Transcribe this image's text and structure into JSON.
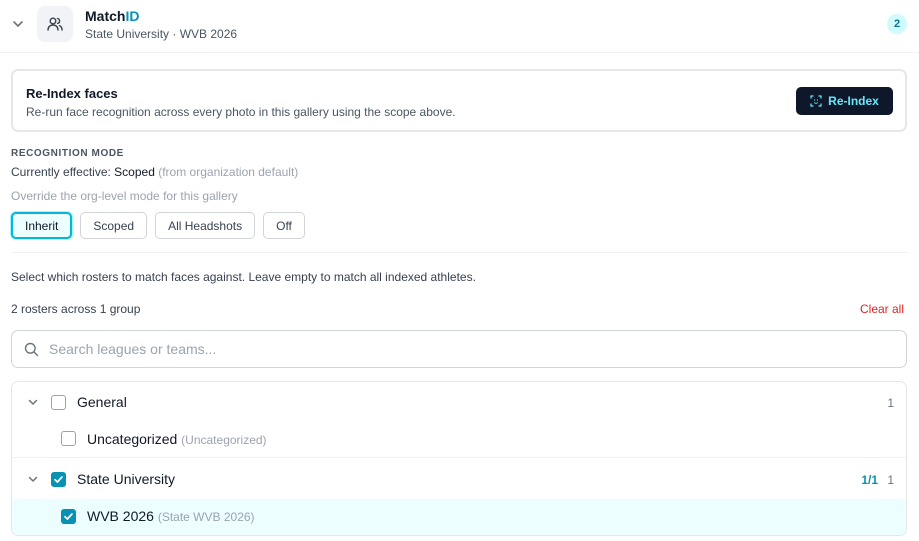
{
  "header": {
    "title_main": "Match",
    "title_accent": "ID",
    "subtitle": "State University · WVB 2026",
    "badge_count": "2",
    "collapse_icon": "chevron-down-icon",
    "app_icon": "users-icon"
  },
  "reindex": {
    "title": "Re-Index faces",
    "description": "Re-run face recognition across every photo in this gallery using the scope above.",
    "button_label": "Re-Index",
    "button_icon": "face-scan-icon"
  },
  "recognition": {
    "section_label": "RECOGNITION MODE",
    "effective_prefix": "Currently effective:",
    "effective_value": "Scoped",
    "effective_note": "(from organization default)",
    "override_hint": "Override the org-level mode for this gallery",
    "modes": [
      {
        "label": "Inherit",
        "active": true
      },
      {
        "label": "Scoped",
        "active": false
      },
      {
        "label": "All Headshots",
        "active": false
      },
      {
        "label": "Off",
        "active": false
      }
    ]
  },
  "rosters": {
    "hint": "Select which rosters to match faces against. Leave empty to match all indexed athletes.",
    "summary": "2 rosters across 1 group",
    "clear_label": "Clear all",
    "search_placeholder": "Search leagues or teams...",
    "groups": [
      {
        "name": "General",
        "checked": false,
        "count": "1",
        "ratio": "",
        "items": [
          {
            "name": "Uncategorized",
            "detail": "(Uncategorized)",
            "checked": false
          }
        ]
      },
      {
        "name": "State University",
        "checked": true,
        "count": "1",
        "ratio": "1/1",
        "items": [
          {
            "name": "WVB 2026",
            "detail": "(State WVB 2026)",
            "checked": true
          }
        ]
      }
    ]
  },
  "colors": {
    "accent": "#0891b2",
    "danger": "#dc2626",
    "dark_button": "#0f172a",
    "selected_row": "#ecfeff"
  }
}
